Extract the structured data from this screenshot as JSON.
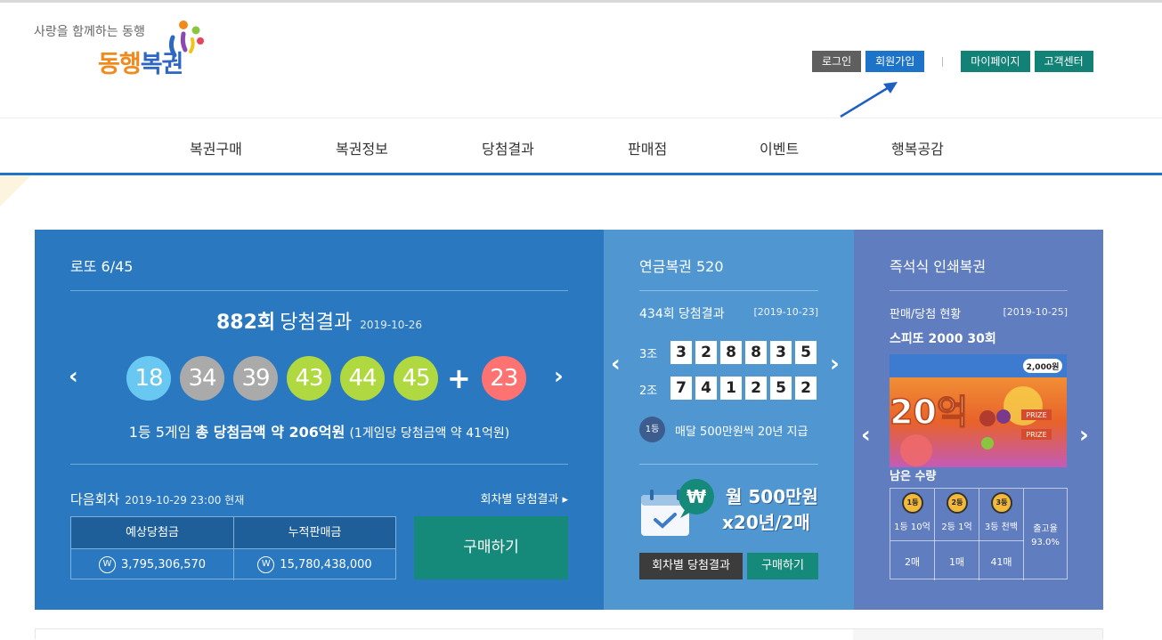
{
  "header": {
    "tagline": "사랑을 함께하는 동행",
    "brand_part1": "동행",
    "brand_part2": "복권",
    "util_buttons": {
      "login": "로그인",
      "join": "회원가입",
      "mypage": "마이페이지",
      "support": "고객센터"
    }
  },
  "nav": [
    "복권구매",
    "복권정보",
    "당첨결과",
    "판매점",
    "이벤트",
    "행복공감"
  ],
  "lotto": {
    "title": "로또 6/45",
    "round": "882회",
    "result_label": "당첨결과",
    "date": "2019-10-26",
    "numbers": [
      "18",
      "34",
      "39",
      "43",
      "44",
      "45"
    ],
    "number_colors": [
      "#69c8f2",
      "#aaaaaa",
      "#aaaaaa",
      "#b0d840",
      "#b0d840",
      "#b0d840"
    ],
    "plus": "+",
    "bonus": "23",
    "bonus_color": "#ff7272",
    "prize_prefix": "1등 5게임 ",
    "prize_main": "총 당첨금액 약 206억원",
    "prize_sub": "(1게임당 당첨금액 약 41억원)",
    "next_label": "다음회차",
    "next_date": "2019-10-29 23:00 현재",
    "by_round_link": "회차별 당첨결과 ▸",
    "table": {
      "col1": "예상당첨금",
      "col2": "누적판매금",
      "val1": "3,795,306,570",
      "val2": "15,780,438,000",
      "won_symbol": "W"
    },
    "buy": "구매하기"
  },
  "pension": {
    "title": "연금복권 520",
    "round_label": "434회 당첨결과",
    "date": "[2019-10-23]",
    "groups": [
      {
        "label": "3조",
        "digits": [
          "3",
          "2",
          "8",
          "8",
          "3",
          "5"
        ]
      },
      {
        "label": "2조",
        "digits": [
          "7",
          "4",
          "1",
          "2",
          "5",
          "2"
        ]
      }
    ],
    "rank_badge": "1등",
    "payout": "매달 500만원씩 20년 지급",
    "won_badge": "₩",
    "slogan1": "월 500만원",
    "slogan2": "x20년/2매",
    "btn_results": "회차별 당첨결과",
    "btn_buy": "구매하기"
  },
  "instant": {
    "title": "즉석식 인쇄복권",
    "status_label": "판매/당첨 현황",
    "date": "[2019-10-25]",
    "game": "스피또 2000 30회",
    "ticket_text": "20억",
    "ticket_price": "2,000원",
    "ticket_prize_word": "PRIZE",
    "remain_label": "남은 수량",
    "ranks": [
      {
        "medal": "1등",
        "label": "1등 10억",
        "count": "2매"
      },
      {
        "medal": "2등",
        "label": "2등 1억",
        "count": "1매"
      },
      {
        "medal": "3등",
        "label": "3등 천백",
        "count": "41매"
      }
    ],
    "release_label": "출고율",
    "release_value": "93.0%"
  }
}
